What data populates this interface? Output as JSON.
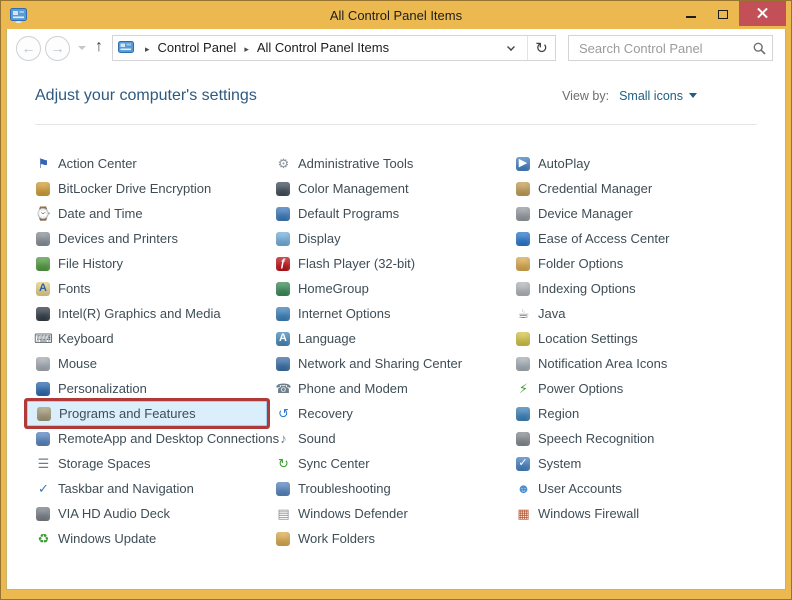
{
  "window": {
    "title": "All Control Panel Items"
  },
  "navbar": {
    "back_icon": "←",
    "forward_icon": "→",
    "up_icon": "↑",
    "refresh_icon": "↻",
    "breadcrumb": {
      "separator": "▸",
      "items": [
        "Control Panel",
        "All Control Panel Items"
      ]
    },
    "search": {
      "placeholder": "Search Control Panel"
    }
  },
  "header": {
    "title": "Adjust your computer's settings",
    "view_by_label": "View by:",
    "view_by_value": "Small icons"
  },
  "colors": {
    "titlebar": "#ecb950",
    "close_button": "#c25056",
    "highlight_border": "#b03a38",
    "highlight_fill": "#daeefb",
    "header_text": "#2d5a82",
    "link": "#1f5e83",
    "item_text": "#3f4d56"
  },
  "items": {
    "columns": [
      [
        {
          "label": "Action Center",
          "icon": "action-center",
          "g": "⚑",
          "c": "#3565b4"
        },
        {
          "label": "BitLocker Drive Encryption",
          "icon": "bitlocker-drive-encryption",
          "g": "",
          "bg": "#d7a43c"
        },
        {
          "label": "Date and Time",
          "icon": "date-and-time",
          "g": "⌚",
          "c": "#6e7d8a"
        },
        {
          "label": "Devices and Printers",
          "icon": "devices-and-printers",
          "g": "",
          "bg": "#8d959c"
        },
        {
          "label": "File History",
          "icon": "file-history",
          "g": "",
          "bg": "#57a146"
        },
        {
          "label": "Fonts",
          "icon": "fonts",
          "g": "A",
          "c": "#2b5fa3",
          "bg": "#eed98f"
        },
        {
          "label": "Intel(R) Graphics and Media",
          "icon": "intel-graphics-and-media",
          "g": "",
          "bg": "#37404a"
        },
        {
          "label": "Keyboard",
          "icon": "keyboard",
          "g": "⌨",
          "c": "#5f6a73"
        },
        {
          "label": "Mouse",
          "icon": "mouse",
          "g": "",
          "bg": "#aab2b8"
        },
        {
          "label": "Personalization",
          "icon": "personalization",
          "g": "",
          "bg": "#2f6db3"
        },
        {
          "label": "Programs and Features",
          "icon": "programs-and-features",
          "g": "",
          "bg": "#a79f7d",
          "highlighted": true
        },
        {
          "label": "RemoteApp and Desktop Connections",
          "icon": "remoteapp-and-desktop-connections",
          "g": "",
          "bg": "#5b8ac5"
        },
        {
          "label": "Storage Spaces",
          "icon": "storage-spaces",
          "g": "☰",
          "c": "#6e7d8a"
        },
        {
          "label": "Taskbar and Navigation",
          "icon": "taskbar-and-navigation",
          "g": "✓",
          "c": "#3b78c3"
        },
        {
          "label": "VIA HD Audio Deck",
          "icon": "via-hd-audio-deck",
          "g": "",
          "bg": "#7d858c"
        },
        {
          "label": "Windows Update",
          "icon": "windows-update",
          "g": "♻",
          "c": "#3f9c35"
        }
      ],
      [
        {
          "label": "Administrative Tools",
          "icon": "administrative-tools",
          "g": "⚙",
          "c": "#8a9096"
        },
        {
          "label": "Color Management",
          "icon": "color-management",
          "g": "",
          "bg": "#455260"
        },
        {
          "label": "Default Programs",
          "icon": "default-programs",
          "g": "",
          "bg": "#3f7ec1"
        },
        {
          "label": "Display",
          "icon": "display",
          "g": "",
          "bg": "#79b5e3"
        },
        {
          "label": "Flash Player (32-bit)",
          "icon": "flash-player",
          "g": "ƒ",
          "c": "#ffffff",
          "bg": "#c4161c"
        },
        {
          "label": "HomeGroup",
          "icon": "homegroup",
          "g": "",
          "bg": "#3f8f5c"
        },
        {
          "label": "Internet Options",
          "icon": "internet-options",
          "g": "",
          "bg": "#4186c0"
        },
        {
          "label": "Language",
          "icon": "language",
          "g": "A",
          "c": "#ffffff",
          "bg": "#4a90c2"
        },
        {
          "label": "Network and Sharing Center",
          "icon": "network-and-sharing-center",
          "g": "",
          "bg": "#3e74ad"
        },
        {
          "label": "Phone and Modem",
          "icon": "phone-and-modem",
          "g": "☎",
          "c": "#6e7d8a"
        },
        {
          "label": "Recovery",
          "icon": "recovery",
          "g": "↺",
          "c": "#2e7dd1"
        },
        {
          "label": "Sound",
          "icon": "sound",
          "g": "♪",
          "c": "#6e7d8a"
        },
        {
          "label": "Sync Center",
          "icon": "sync-center",
          "g": "↻",
          "c": "#3f9c35"
        },
        {
          "label": "Troubleshooting",
          "icon": "troubleshooting",
          "g": "",
          "bg": "#5b8ac5"
        },
        {
          "label": "Windows Defender",
          "icon": "windows-defender",
          "g": "▤",
          "c": "#8a8f94"
        },
        {
          "label": "Work Folders",
          "icon": "work-folders",
          "g": "",
          "bg": "#e0b054"
        }
      ],
      [
        {
          "label": "AutoPlay",
          "icon": "autoplay",
          "g": "▶",
          "c": "#ffffff",
          "bg": "#4a86c8"
        },
        {
          "label": "Credential Manager",
          "icon": "credential-manager",
          "g": "",
          "bg": "#c9a35a"
        },
        {
          "label": "Device Manager",
          "icon": "device-manager",
          "g": "",
          "bg": "#9aa0a6"
        },
        {
          "label": "Ease of Access Center",
          "icon": "ease-of-access-center",
          "g": "",
          "bg": "#2e7dd1"
        },
        {
          "label": "Folder Options",
          "icon": "folder-options",
          "g": "",
          "bg": "#e0b054"
        },
        {
          "label": "Indexing Options",
          "icon": "indexing-options",
          "g": "",
          "bg": "#b7bcc0"
        },
        {
          "label": "Java",
          "icon": "java",
          "g": "☕",
          "c": "#5f6a73"
        },
        {
          "label": "Location Settings",
          "icon": "location-settings",
          "g": "",
          "bg": "#d9c94a"
        },
        {
          "label": "Notification Area Icons",
          "icon": "notification-area-icons",
          "g": "",
          "bg": "#aab4bd"
        },
        {
          "label": "Power Options",
          "icon": "power-options",
          "g": "⚡",
          "c": "#3f9c35"
        },
        {
          "label": "Region",
          "icon": "region",
          "g": "",
          "bg": "#4186c0"
        },
        {
          "label": "Speech Recognition",
          "icon": "speech-recognition",
          "g": "",
          "bg": "#8a9096"
        },
        {
          "label": "System",
          "icon": "system",
          "g": "✓",
          "c": "#ffffff",
          "bg": "#4a86c8"
        },
        {
          "label": "User Accounts",
          "icon": "user-accounts",
          "g": "☻",
          "c": "#4e8fd0"
        },
        {
          "label": "Windows Firewall",
          "icon": "windows-firewall",
          "g": "▦",
          "c": "#b3542e"
        }
      ]
    ]
  }
}
